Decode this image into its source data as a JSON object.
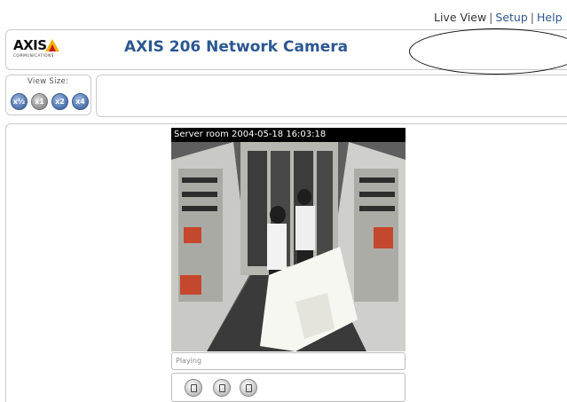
{
  "header": {
    "logo_text": "AXIS",
    "logo_sub": "COMMUNICATIONS",
    "title": "AXIS 206  Network Camera",
    "nav": {
      "live_view": "Live View",
      "separator": "|",
      "setup": "Setup",
      "help": "Help"
    }
  },
  "view_size": {
    "label": "View Size:",
    "buttons": [
      "x½",
      "x1",
      "x2",
      "x4"
    ]
  },
  "video": {
    "overlay": "Server room  2004-05-18 16:03:18"
  },
  "status": {
    "text": "Playing"
  },
  "controls": {
    "icons": [
      "stop-icon",
      "snapshot-icon",
      "save-icon"
    ]
  },
  "colors": {
    "title": "#2c5791",
    "link": "#2c5791",
    "logo_yellow": "#f2b300",
    "logo_red": "#d01818"
  }
}
